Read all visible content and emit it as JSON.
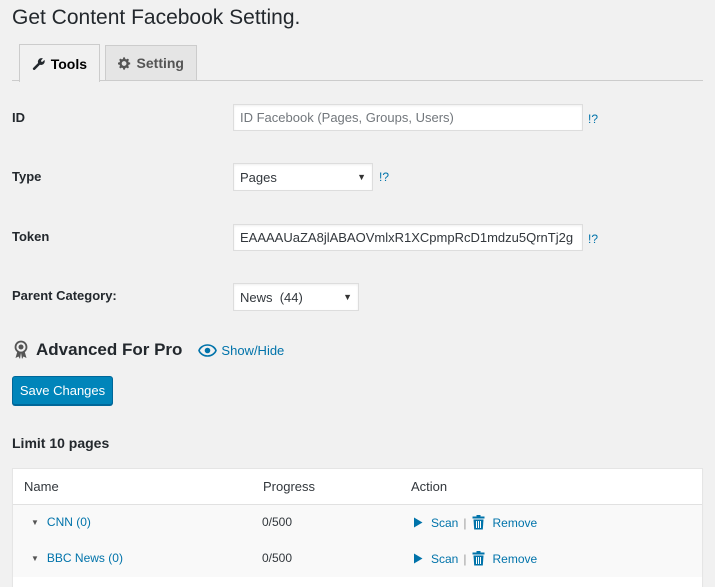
{
  "page": {
    "title": "Get Content Facebook Setting."
  },
  "tabs": [
    {
      "label": "Tools",
      "icon": "wrench-icon",
      "active": true
    },
    {
      "label": "Setting",
      "icon": "gear-icon",
      "active": false
    }
  ],
  "form": {
    "id": {
      "label": "ID",
      "value": "",
      "placeholder": "ID Facebook (Pages, Groups, Users)",
      "help": "!?"
    },
    "type": {
      "label": "Type",
      "value": "Pages",
      "help": "!?"
    },
    "token": {
      "label": "Token",
      "value": "EAAAAUaZA8jlABAOVmlxR1XCpmpRcD1mdzu5QrnTj2g",
      "help": "!?"
    },
    "parent_category": {
      "label": "Parent Category:",
      "value": "News  (44)"
    }
  },
  "advanced": {
    "title": "Advanced For Pro",
    "icon": "award-ribbon-icon",
    "toggle_label": "Show/Hide",
    "toggle_icon": "eye-icon"
  },
  "save_label": "Save Changes",
  "limit_text": "Limit 10 pages",
  "table": {
    "headers": [
      "Name",
      "Progress",
      "Action"
    ],
    "rows": [
      {
        "name": "CNN (0)",
        "progress": "0/500",
        "scan": "Scan",
        "separator": "|",
        "remove": "Remove"
      },
      {
        "name": "BBC News (0)",
        "progress": "0/500",
        "scan": "Scan",
        "separator": "|",
        "remove": "Remove"
      }
    ]
  },
  "colors": {
    "background": "#f1f1f1",
    "link": "#0073aa",
    "primary_button": "#0085ba"
  }
}
